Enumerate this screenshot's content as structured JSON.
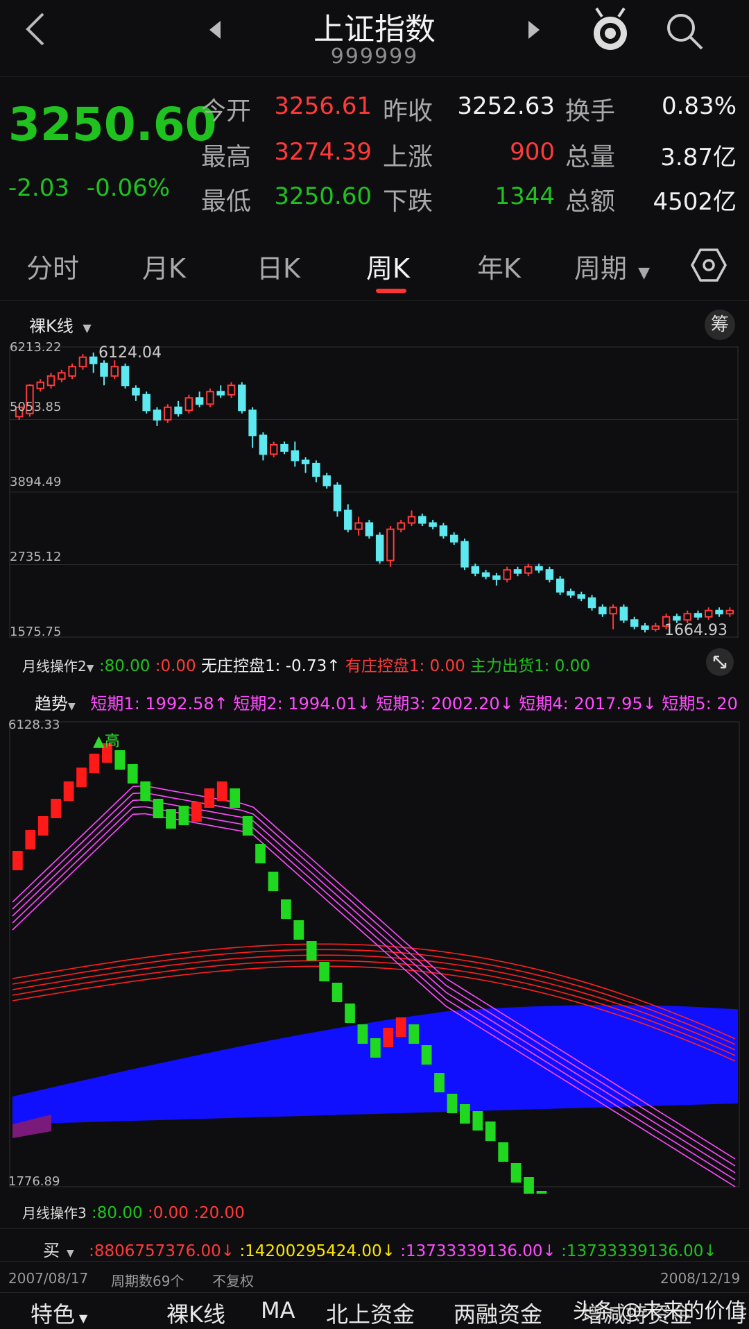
{
  "header": {
    "title": "上证指数",
    "code": "999999"
  },
  "quote": {
    "price": "3250.60",
    "change": "-2.03",
    "change_pct": "-0.06%",
    "fields": [
      {
        "label": "今开",
        "value": "3256.61",
        "color": "red"
      },
      {
        "label": "昨收",
        "value": "3252.63",
        "color": "white"
      },
      {
        "label": "换手",
        "value": "0.83%",
        "color": "white"
      },
      {
        "label": "最高",
        "value": "3274.39",
        "color": "red"
      },
      {
        "label": "上涨",
        "value": "900",
        "color": "red"
      },
      {
        "label": "总量",
        "value": "3.87亿",
        "color": "white"
      },
      {
        "label": "最低",
        "value": "3250.60",
        "color": "green"
      },
      {
        "label": "下跌",
        "value": "1344",
        "color": "green"
      },
      {
        "label": "总额",
        "value": "4502亿",
        "color": "white"
      }
    ]
  },
  "tabs": [
    {
      "label": "分时"
    },
    {
      "label": "月K"
    },
    {
      "label": "日K"
    },
    {
      "label": "周K",
      "active": true
    },
    {
      "label": "年K"
    },
    {
      "label": "周期"
    }
  ],
  "main_chart": {
    "selector_label": "裸K线",
    "chip_label": "筹",
    "y_ticks": [
      "6213.22",
      "5053.85",
      "3894.49",
      "2735.12",
      "1575.75"
    ],
    "high_label": "6124.04",
    "low_label": "1664.93"
  },
  "indicator1": {
    "name": "月线操作2",
    "items": [
      {
        "text": ":80.00",
        "color": "green"
      },
      {
        "text": ":0.00",
        "color": "red"
      },
      {
        "text": "无庄控盘1: -0.73↑",
        "color": "white"
      },
      {
        "text": "有庄控盘1: 0.00",
        "color": "red"
      },
      {
        "text": "主力出货1: 0.00",
        "color": "green"
      }
    ]
  },
  "trend": {
    "name": "趋势",
    "items": [
      {
        "text": "短期1: 1992.58↑"
      },
      {
        "text": "短期2: 1994.01↓"
      },
      {
        "text": "短期3: 2002.20↓"
      },
      {
        "text": "短期4: 2017.95↓"
      },
      {
        "text": "短期5: 20"
      }
    ],
    "y_top": "6128.33",
    "y_bottom": "1776.89",
    "marker": "▲高"
  },
  "indicator2": {
    "name": "月线操作3",
    "items": [
      {
        "text": ":80.00",
        "color": "green"
      },
      {
        "text": ":0.00",
        "color": "red"
      },
      {
        "text": ":20.00",
        "color": "red"
      }
    ]
  },
  "indicator3": {
    "name": "买",
    "items": [
      {
        "text": ":8806757376.00↓",
        "color": "red"
      },
      {
        "text": ":14200295424.00↓",
        "color": "yellow"
      },
      {
        "text": ":13733339136.00↓",
        "color": "magenta"
      },
      {
        "text": ":13733339136.00↓",
        "color": "green"
      }
    ]
  },
  "footer": {
    "start_date": "2007/08/17",
    "period_count": "周期数69个",
    "adjust": "不复权",
    "end_date": "2008/12/19"
  },
  "bottom_nav": [
    {
      "label": "特色"
    },
    {
      "label": "裸K线",
      "active": true
    },
    {
      "label": "MA"
    },
    {
      "label": "北上资金"
    },
    {
      "label": "两融资金"
    },
    {
      "label": "增减持资金"
    },
    {
      "label": "扌"
    }
  ],
  "watermark": "头条 @未来的价值",
  "chart_data": {
    "type": "candlestick",
    "period": "weekly",
    "ylim": [
      1575.75,
      6213.22
    ],
    "candles": [
      [
        5100,
        5250,
        5050,
        5300,
        "up"
      ],
      [
        5150,
        5600,
        5100,
        5620,
        "up"
      ],
      [
        5550,
        5650,
        5500,
        5700,
        "up"
      ],
      [
        5600,
        5750,
        5550,
        5800,
        "up"
      ],
      [
        5700,
        5800,
        5650,
        5850,
        "up"
      ],
      [
        5750,
        5900,
        5700,
        5950,
        "up"
      ],
      [
        5900,
        6050,
        5850,
        6100,
        "up"
      ],
      [
        6050,
        5950,
        5800,
        6124,
        "down"
      ],
      [
        5950,
        5750,
        5600,
        6000,
        "down"
      ],
      [
        5750,
        5900,
        5700,
        6000,
        "up"
      ],
      [
        5900,
        5600,
        5550,
        5950,
        "down"
      ],
      [
        5550,
        5450,
        5350,
        5600,
        "down"
      ],
      [
        5450,
        5200,
        5150,
        5500,
        "down"
      ],
      [
        5200,
        5050,
        4950,
        5250,
        "down"
      ],
      [
        5050,
        5250,
        5000,
        5300,
        "up"
      ],
      [
        5250,
        5150,
        5100,
        5350,
        "down"
      ],
      [
        5200,
        5400,
        5150,
        5450,
        "up"
      ],
      [
        5400,
        5300,
        5250,
        5500,
        "down"
      ],
      [
        5300,
        5500,
        5250,
        5550,
        "up"
      ],
      [
        5500,
        5450,
        5400,
        5600,
        "down"
      ],
      [
        5450,
        5600,
        5400,
        5650,
        "up"
      ],
      [
        5600,
        5200,
        5150,
        5650,
        "down"
      ],
      [
        5200,
        4800,
        4600,
        5250,
        "down"
      ],
      [
        4800,
        4500,
        4400,
        4850,
        "down"
      ],
      [
        4500,
        4650,
        4450,
        4700,
        "up"
      ],
      [
        4650,
        4550,
        4500,
        4700,
        "down"
      ],
      [
        4550,
        4400,
        4300,
        4700,
        "down"
      ],
      [
        4400,
        4350,
        4200,
        4450,
        "down"
      ],
      [
        4350,
        4150,
        4050,
        4400,
        "down"
      ],
      [
        4150,
        4000,
        3950,
        4200,
        "down"
      ],
      [
        4000,
        3600,
        3500,
        4050,
        "down"
      ],
      [
        3600,
        3300,
        3250,
        3700,
        "down"
      ],
      [
        3300,
        3400,
        3200,
        3500,
        "up"
      ],
      [
        3400,
        3200,
        3150,
        3450,
        "down"
      ],
      [
        3200,
        2800,
        2750,
        3250,
        "down"
      ],
      [
        2800,
        3300,
        2700,
        3350,
        "up"
      ],
      [
        3300,
        3400,
        3250,
        3450,
        "up"
      ],
      [
        3400,
        3500,
        3350,
        3600,
        "up"
      ],
      [
        3500,
        3400,
        3350,
        3550,
        "down"
      ],
      [
        3400,
        3350,
        3300,
        3450,
        "down"
      ],
      [
        3350,
        3200,
        3150,
        3400,
        "down"
      ],
      [
        3200,
        3100,
        3050,
        3250,
        "down"
      ],
      [
        3100,
        2700,
        2650,
        3150,
        "down"
      ],
      [
        2700,
        2600,
        2550,
        2750,
        "down"
      ],
      [
        2600,
        2550,
        2500,
        2650,
        "down"
      ],
      [
        2550,
        2500,
        2400,
        2600,
        "down"
      ],
      [
        2500,
        2650,
        2450,
        2700,
        "up"
      ],
      [
        2650,
        2600,
        2550,
        2700,
        "down"
      ],
      [
        2600,
        2700,
        2550,
        2750,
        "up"
      ],
      [
        2700,
        2650,
        2600,
        2750,
        "down"
      ],
      [
        2650,
        2500,
        2450,
        2700,
        "down"
      ],
      [
        2500,
        2300,
        2250,
        2550,
        "down"
      ],
      [
        2300,
        2250,
        2200,
        2350,
        "down"
      ],
      [
        2250,
        2200,
        2150,
        2300,
        "down"
      ],
      [
        2200,
        2050,
        2000,
        2250,
        "down"
      ],
      [
        2050,
        1950,
        1900,
        2100,
        "down"
      ],
      [
        1950,
        2050,
        1700,
        2100,
        "up"
      ],
      [
        2050,
        1850,
        1800,
        2100,
        "down"
      ],
      [
        1850,
        1750,
        1700,
        1900,
        "down"
      ],
      [
        1750,
        1700,
        1650,
        1800,
        "down"
      ],
      [
        1700,
        1750,
        1664,
        1800,
        "up"
      ],
      [
        1750,
        1900,
        1700,
        1950,
        "up"
      ],
      [
        1900,
        1850,
        1800,
        1950,
        "down"
      ],
      [
        1850,
        1950,
        1800,
        2000,
        "up"
      ],
      [
        1950,
        1900,
        1850,
        2000,
        "down"
      ],
      [
        1900,
        2000,
        1850,
        2050,
        "up"
      ],
      [
        2000,
        1950,
        1900,
        2050,
        "down"
      ],
      [
        1950,
        2000,
        1900,
        2050,
        "up"
      ]
    ]
  },
  "colors": {
    "up": "#ff3a3a",
    "down": "#5ee8f0",
    "trend_up": "#ff1a1a",
    "trend_down": "#1fd81f",
    "band_short": "#ff4cff",
    "band_long": "#ff2020",
    "area": "#1010ff"
  }
}
